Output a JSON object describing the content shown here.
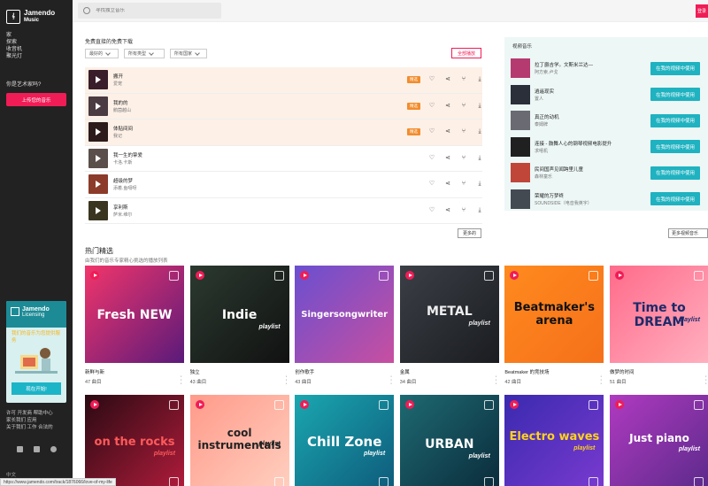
{
  "brand": {
    "line1": "Jamendo",
    "line2": "Music"
  },
  "sidebar": {
    "nav": [
      "家",
      "探索",
      "收音机",
      "聚光灯"
    ],
    "artist_question": "你是艺术家吗?",
    "upload_label": "上传您的音乐",
    "licensing": {
      "title1": "Jamendo",
      "title2": "Licensing",
      "tagline": "我们的音乐为您提供服务",
      "button": "现在开始!"
    },
    "footer_links": [
      "许可",
      "开发商",
      "帮助中心",
      "家长我们",
      "应用",
      "关于我们",
      "工作",
      "合法的"
    ],
    "language": "中文"
  },
  "search": {
    "placeholder": "寻找独立音乐"
  },
  "login_label": "登录",
  "downloads": {
    "title": "免费直接的免费下载",
    "filters": [
      "最好的",
      "所有类型",
      "所有国家"
    ],
    "play_all": "全部播放",
    "tracks": [
      {
        "name": "搬开",
        "artist": "爱宠",
        "badge": "精选",
        "highlight": true,
        "color": "#3a1d2a"
      },
      {
        "name": "我的的",
        "artist": "鹅茵越山",
        "badge": "精选",
        "highlight": true,
        "color": "#4a3a42"
      },
      {
        "name": "体贴间间",
        "artist": "我记",
        "badge": "精选",
        "highlight": true,
        "color": "#2d1b1b"
      },
      {
        "name": "我一生的挚爱",
        "artist": "卡洛.卡斯",
        "badge": "",
        "highlight": false,
        "color": "#5a4f4a"
      },
      {
        "name": "超级的梦",
        "artist": "添着.鱼嗝呀",
        "badge": "",
        "highlight": false,
        "color": "#8c3b2a"
      },
      {
        "name": "享利斯",
        "artist": "萨米.维尔",
        "badge": "",
        "highlight": false,
        "color": "#3a3520"
      }
    ],
    "more": "更多的"
  },
  "video_music": {
    "title": "视频音乐",
    "use_label": "在我的视频中使用",
    "items": [
      {
        "name": "拉丁爵吉学。文斯米兰达—",
        "artist": "阿方索.卢戈",
        "color": "#b53a6f"
      },
      {
        "name": "逍遥现实",
        "artist": "置人",
        "color": "#2a2f3a"
      },
      {
        "name": "真正的动机",
        "artist": "泰姆牌",
        "color": "#6a6a72"
      },
      {
        "name": "连接 - 鼓舞人心的钢琴视频电影提升",
        "artist": "求嘻机",
        "color": "#202020"
      },
      {
        "name": "民间国声见闻跨里儿童",
        "artist": "森林童乐",
        "color": "#c0463a"
      },
      {
        "name": "荣耀的万梦终",
        "artist": "SOUNDSIDE（电音我英字）",
        "color": "#444a52"
      }
    ],
    "more": "更多视频音乐"
  },
  "playlists": {
    "title": "热门精选",
    "subtitle": "由我们的音乐专家精心挑选的播放列表",
    "items": [
      {
        "art_title": "Fresh NEW",
        "name": "新鲜与新",
        "count": "47 曲目"
      },
      {
        "art_title": "Indie",
        "art_small": "playlist",
        "name": "独立",
        "count": "43 曲目"
      },
      {
        "art_title": "Singersongwriter",
        "name": "创作歌手",
        "count": "43 曲目"
      },
      {
        "art_title": "METAL",
        "art_small": "playlist",
        "name": "金属",
        "count": "34 曲目"
      },
      {
        "art_title": "Beatmaker's arena",
        "name": "Beatmaker 的竞技场",
        "count": "42 曲目"
      },
      {
        "art_title": "Time to DREAM",
        "art_small": "playlist",
        "name": "做梦的时间",
        "count": "51 曲目"
      },
      {
        "art_title": "on the rocks",
        "art_small": "playlist"
      },
      {
        "art_title": "cool instrumentals",
        "art_small": "playlist"
      },
      {
        "art_title": "Chill Zone",
        "art_small": "playlist"
      },
      {
        "art_title": "URBAN",
        "art_small": "playlist"
      },
      {
        "art_title": "Electro waves",
        "art_small": "playlist"
      },
      {
        "art_title": "Just piano",
        "art_small": "playlist"
      }
    ]
  },
  "status_url": "https://www.jamendo.com/track/1876066/love-of-my-life",
  "colors": {
    "accent": "#f01c56",
    "teal": "#1fb2c0",
    "badge": "#f28d2d",
    "sidebar": "#222222"
  }
}
